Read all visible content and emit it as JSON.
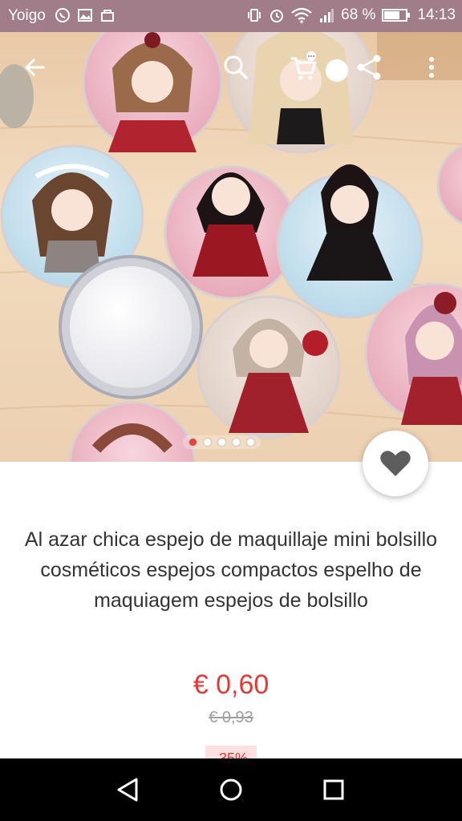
{
  "status_bar": {
    "carrier": "Yoigo",
    "battery": "68 %",
    "time": "14:13"
  },
  "product": {
    "title": "Al azar chica espejo de maquillaje mini bolsillo cosméticos espejos compactos espelho de maquiagem espejos de bolsillo",
    "price": "€ 0,60",
    "old_price": "€ 0,93",
    "discount": "-35%",
    "image_count": 5,
    "active_image": 1
  },
  "actions": {
    "back_icon": "arrow-left-icon",
    "search_icon": "search-icon",
    "cart_icon": "cart-icon",
    "share_icon": "share-icon",
    "more_icon": "more-vertical-icon",
    "favorite_icon": "heart-icon"
  },
  "colors": {
    "status_bar": "#a07d88",
    "price": "#e53935",
    "active_dot": "#e0463f"
  }
}
